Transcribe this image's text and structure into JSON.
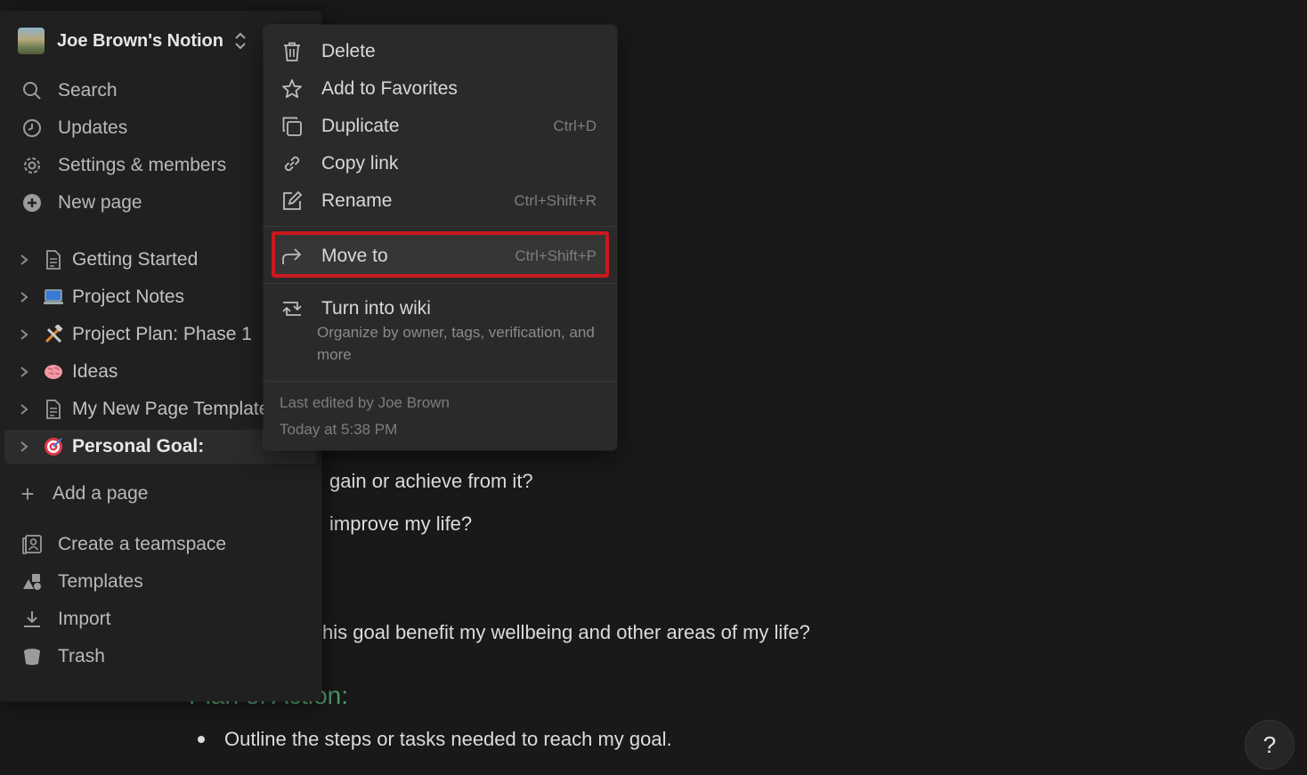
{
  "workspace": {
    "name": "Joe Brown's Notion"
  },
  "nav": {
    "search": "Search",
    "updates": "Updates",
    "settings": "Settings & members",
    "new_page": "New page"
  },
  "pages": [
    {
      "label": "Getting Started",
      "icon": "document-icon"
    },
    {
      "label": "Project Notes",
      "icon": "laptop-emoji",
      "emoji": "💻"
    },
    {
      "label": "Project Plan: Phase 1",
      "icon": "hammer-wrench-emoji",
      "emoji": "⚒"
    },
    {
      "label": "Ideas",
      "icon": "brain-emoji",
      "emoji": "🧠"
    },
    {
      "label": "My New Page Template",
      "icon": "document-icon"
    },
    {
      "label": "Personal Goal:",
      "icon": "target-emoji",
      "emoji": "🎯",
      "active": true
    }
  ],
  "add_page": "Add a page",
  "bottom_nav": {
    "teamspace": "Create a teamspace",
    "templates": "Templates",
    "import": "Import",
    "trash": "Trash"
  },
  "menu": {
    "delete": "Delete",
    "favorites": "Add to Favorites",
    "duplicate": "Duplicate",
    "duplicate_shortcut": "Ctrl+D",
    "copy_link": "Copy link",
    "rename": "Rename",
    "rename_shortcut": "Ctrl+Shift+R",
    "move_to": "Move to",
    "move_to_shortcut": "Ctrl+Shift+P",
    "turn_into_wiki": "Turn into wiki",
    "wiki_description": "Organize by owner, tags, verification, and more",
    "last_edited": "Last edited by Joe Brown",
    "edited_time": "Today at 5:38 PM"
  },
  "content": {
    "line1": "gain or achieve from it?",
    "line2": "improve my life?",
    "line3": "his goal benefit my wellbeing and other areas of my life?",
    "heading": "Plan of Action:",
    "bullet1": "Outline the steps or tasks needed to reach my goal."
  },
  "help": "?"
}
